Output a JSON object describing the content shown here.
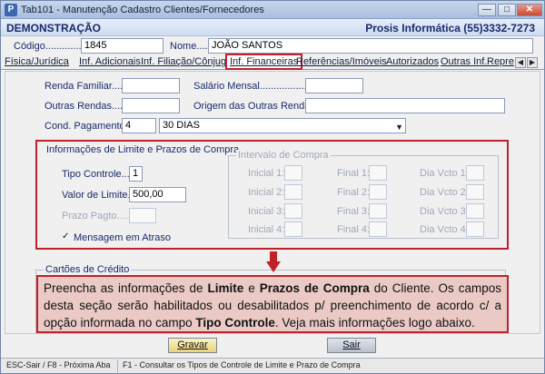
{
  "window": {
    "title": "Tab101 - Manutenção Cadastro Clientes/Fornecedores",
    "app_icon": "P"
  },
  "header": {
    "company": "DEMONSTRAÇÃO",
    "brand": "Prosis Informática (55)3332-7273"
  },
  "record": {
    "code_label": "Código...............:",
    "code_value": "1845",
    "name_label": "Nome.....:",
    "name_value": "JOÃO SANTOS"
  },
  "tabs": [
    {
      "label": "Física/Jurídica"
    },
    {
      "label": "Inf. Adicionais"
    },
    {
      "label": "Inf. Filiação/Cônjuge"
    },
    {
      "label": "Inf. Financeiras",
      "active": true
    },
    {
      "label": "Referências/Imóveis"
    },
    {
      "label": "Autorizados"
    },
    {
      "label": "Outras Inf."
    },
    {
      "label": "Repre"
    }
  ],
  "finance": {
    "renda_familiar_label": "Renda Familiar.....:",
    "renda_familiar_value": "",
    "salario_mensal_label": "Salário Mensal........................:",
    "salario_mensal_value": "",
    "outras_rendas_label": "Outras Rendas......:",
    "outras_rendas_value": "",
    "origem_label": "Origem das Outras Rendas:",
    "origem_value": "",
    "cond_pagamento_label": "Cond. Pagamento:",
    "cond_pagamento_code": "4",
    "cond_pagamento_desc": "30 DIAS"
  },
  "limits": {
    "group_title": "Informações de Limite e Prazos de Compra",
    "tipo_controle_label": "Tipo Controle.....:",
    "tipo_controle_value": "1",
    "valor_limite_label": "Valor de Limite..:",
    "valor_limite_value": "500,00",
    "prazo_pagto_label": "Prazo Pagto.......:",
    "prazo_pagto_value": "",
    "mensagem_atraso_label": "Mensagem em Atraso",
    "mensagem_atraso_checked": true,
    "interval_title": "Intervalo de Compra",
    "interval_rows": [
      {
        "inicial": "Inicial 1:",
        "final": "Final 1:",
        "dia": "Dia Vcto 1:"
      },
      {
        "inicial": "Inicial 2:",
        "final": "Final 2:",
        "dia": "Dia Vcto 2:"
      },
      {
        "inicial": "Inicial 3:",
        "final": "Final 3:",
        "dia": "Dia Vcto 3:"
      },
      {
        "inicial": "Inicial 4:",
        "final": "Final 4:",
        "dia": "Dia Vcto 4:"
      }
    ]
  },
  "cards": {
    "group_title": "Cartões de Crédito"
  },
  "callout": {
    "t1": "Preencha as informações de ",
    "b1": "Limite",
    "t2": " e ",
    "b2": "Prazos de Compra",
    "t3": " do Cliente. Os campos desta seção serão habilitados ou desabilitados p/ preenchimento de acordo c/ a opção informada no campo ",
    "b3": "Tipo Controle",
    "t4": ". Veja mais informações logo abaixo."
  },
  "buttons": {
    "save": "Gravar",
    "exit": "Sair"
  },
  "status": {
    "left": "ESC-Sair / F8 - Próxima Aba",
    "right": "F1 - Consultar os Tipos de Controle de Limite e Prazo de Compra"
  },
  "colors": {
    "highlight": "#c0202a",
    "callout_bg": "#ebcac6",
    "text": "#1a2a6c"
  }
}
